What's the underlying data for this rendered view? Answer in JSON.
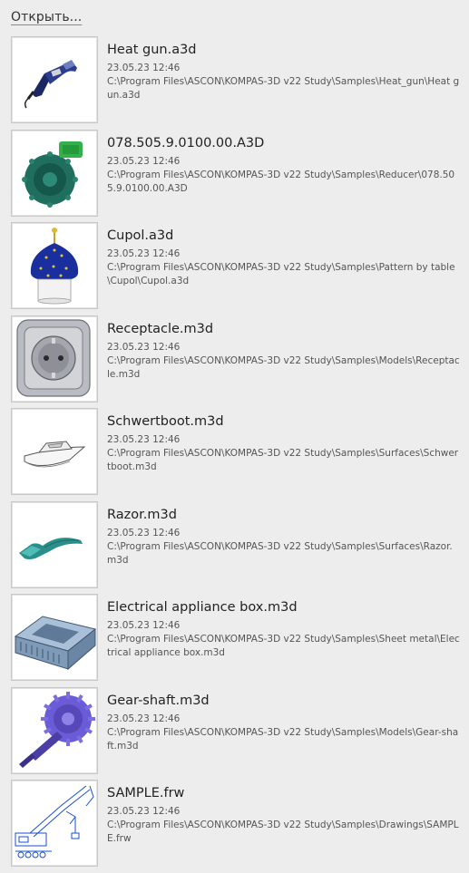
{
  "open_label": "Открыть...",
  "files": [
    {
      "name": "Heat gun.a3d",
      "date": "23.05.23 12:46",
      "path": "C:\\Program Files\\ASCON\\KOMPAS-3D v22 Study\\Samples\\Heat_gun\\Heat gun.a3d",
      "icon": "heat-gun-thumbnail"
    },
    {
      "name": "078.505.9.0100.00.A3D",
      "date": "23.05.23 12:46",
      "path": "C:\\Program Files\\ASCON\\KOMPAS-3D v22 Study\\Samples\\Reducer\\078.505.9.0100.00.A3D",
      "icon": "reducer-thumbnail"
    },
    {
      "name": "Cupol.a3d",
      "date": "23.05.23 12:46",
      "path": "C:\\Program Files\\ASCON\\KOMPAS-3D v22 Study\\Samples\\Pattern by table\\Cupol\\Cupol.a3d",
      "icon": "cupola-thumbnail"
    },
    {
      "name": "Receptacle.m3d",
      "date": "23.05.23 12:46",
      "path": "C:\\Program Files\\ASCON\\KOMPAS-3D v22 Study\\Samples\\Models\\Receptacle.m3d",
      "icon": "receptacle-thumbnail"
    },
    {
      "name": "Schwertboot.m3d",
      "date": "23.05.23 12:46",
      "path": "C:\\Program Files\\ASCON\\KOMPAS-3D v22 Study\\Samples\\Surfaces\\Schwertboot.m3d",
      "icon": "boat-thumbnail"
    },
    {
      "name": "Razor.m3d",
      "date": "23.05.23 12:46",
      "path": "C:\\Program Files\\ASCON\\KOMPAS-3D v22 Study\\Samples\\Surfaces\\Razor.m3d",
      "icon": "razor-thumbnail"
    },
    {
      "name": "Electrical appliance box.m3d",
      "date": "23.05.23 12:46",
      "path": "C:\\Program Files\\ASCON\\KOMPAS-3D v22 Study\\Samples\\Sheet metal\\Electrical appliance box.m3d",
      "icon": "appliance-box-thumbnail"
    },
    {
      "name": "Gear-shaft.m3d",
      "date": "23.05.23 12:46",
      "path": "C:\\Program Files\\ASCON\\KOMPAS-3D v22 Study\\Samples\\Models\\Gear-shaft.m3d",
      "icon": "gear-shaft-thumbnail"
    },
    {
      "name": "SAMPLE.frw",
      "date": "23.05.23 12:46",
      "path": "C:\\Program Files\\ASCON\\KOMPAS-3D v22 Study\\Samples\\Drawings\\SAMPLE.frw",
      "icon": "drawing-thumbnail"
    }
  ]
}
